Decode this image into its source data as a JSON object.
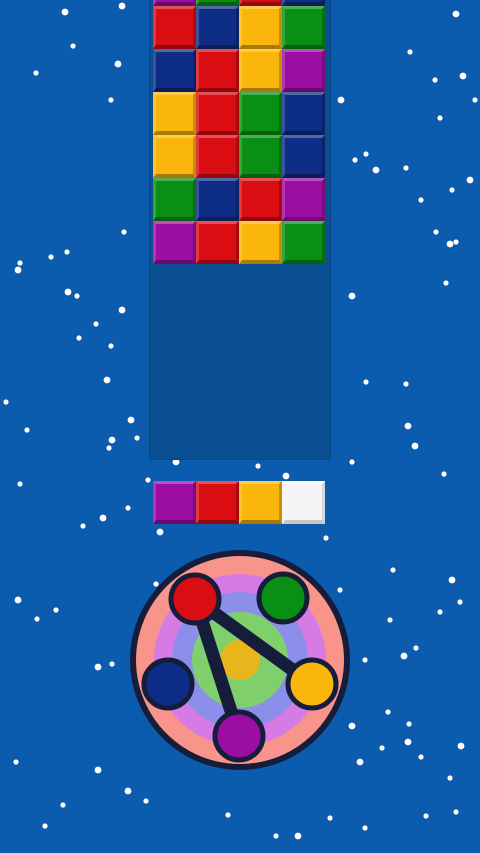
{
  "colors": {
    "background": "#0b5cae",
    "well": "#0a4f92",
    "red": "#d90d12",
    "blue": "#0e2d86",
    "yellow": "#fbb60b",
    "green": "#0a8f15",
    "purple": "#9c0ea3",
    "white": "#f4f4f4",
    "ring_outline": "#151d3b",
    "ring_salmon": "#f8948a",
    "ring_violet": "#d77be4",
    "ring_periwinkle": "#8b8fea",
    "ring_green": "#7fd06c",
    "ring_center": "#e8b51c"
  },
  "board": {
    "columns": 4,
    "rows": [
      [
        "red",
        "blue",
        "yellow",
        "green"
      ],
      [
        "blue",
        "red",
        "yellow",
        "purple"
      ],
      [
        "yellow",
        "red",
        "green",
        "blue"
      ],
      [
        "yellow",
        "red",
        "green",
        "blue"
      ],
      [
        "green",
        "blue",
        "red",
        "purple"
      ],
      [
        "purple",
        "red",
        "yellow",
        "green"
      ]
    ],
    "partial_top_row": [
      "purple",
      "green",
      "red",
      "blue"
    ]
  },
  "next_row": [
    "purple",
    "red",
    "yellow",
    "white"
  ],
  "wheel": {
    "nodes": [
      {
        "id": "red",
        "color": "red"
      },
      {
        "id": "green",
        "color": "green"
      },
      {
        "id": "yellow",
        "color": "yellow"
      },
      {
        "id": "purple",
        "color": "purple"
      },
      {
        "id": "blue",
        "color": "blue"
      }
    ],
    "links": [
      [
        "red",
        "yellow"
      ],
      [
        "red",
        "purple"
      ]
    ]
  }
}
